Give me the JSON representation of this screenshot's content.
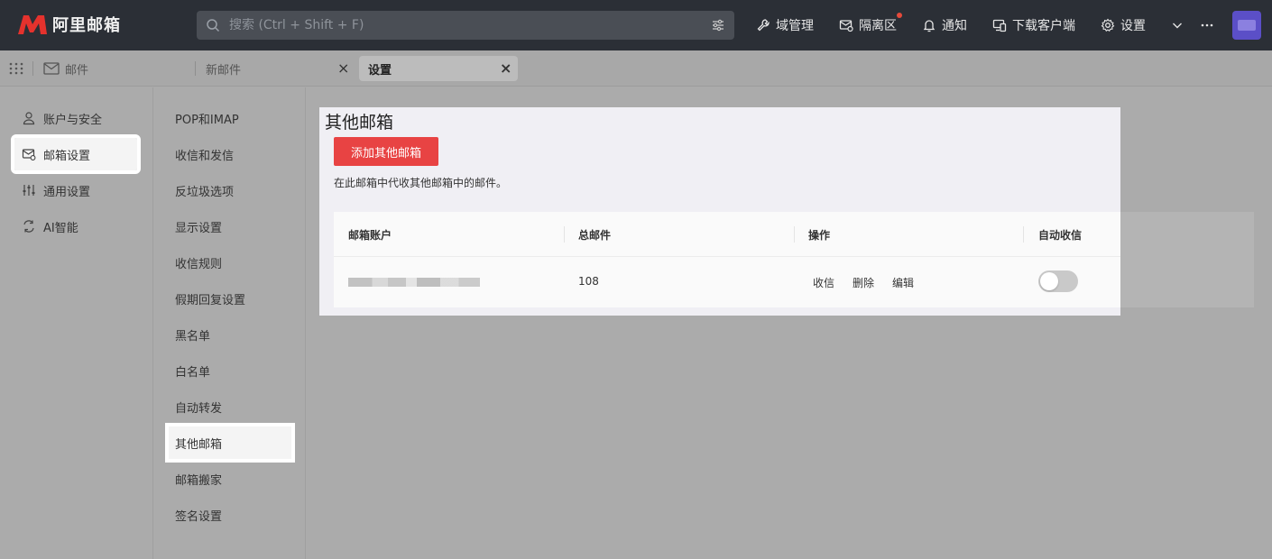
{
  "app": {
    "logo_text": "阿里邮箱",
    "brand_color": "#e5322d"
  },
  "search": {
    "placeholder": "搜索 (Ctrl + Shift + F)"
  },
  "top_actions": {
    "domain": "域管理",
    "quarantine": "隔离区",
    "notify": "通知",
    "download": "下载客户端",
    "settings": "设置"
  },
  "tabs": [
    {
      "label": "邮件"
    },
    {
      "label": "新邮件"
    },
    {
      "label": "设置"
    }
  ],
  "left_nav": [
    {
      "label": "账户与安全",
      "icon": "user-icon"
    },
    {
      "label": "邮箱设置",
      "icon": "mailbox-settings-icon"
    },
    {
      "label": "通用设置",
      "icon": "sliders-icon"
    },
    {
      "label": "AI智能",
      "icon": "ai-icon"
    }
  ],
  "mid_nav": [
    {
      "label": "POP和IMAP"
    },
    {
      "label": "收信和发信"
    },
    {
      "label": "反垃圾选项"
    },
    {
      "label": "显示设置"
    },
    {
      "label": "收信规则"
    },
    {
      "label": "假期回复设置"
    },
    {
      "label": "黑名单"
    },
    {
      "label": "白名单"
    },
    {
      "label": "自动转发"
    },
    {
      "label": "其他邮箱"
    },
    {
      "label": "邮箱搬家"
    },
    {
      "label": "签名设置"
    }
  ],
  "panel": {
    "title": "其他邮箱",
    "add_button": "添加其他邮箱",
    "description": "在此邮箱中代收其他邮箱中的邮件。",
    "table": {
      "headers": [
        "邮箱账户",
        "总邮件",
        "操作",
        "自动收信"
      ],
      "rows": [
        {
          "total": "108",
          "actions": [
            "收信",
            "删除",
            "编辑"
          ],
          "auto_receive": false
        }
      ]
    }
  },
  "colors": {
    "accent_red": "#e84343",
    "topbar_bg": "#2b2f36"
  }
}
